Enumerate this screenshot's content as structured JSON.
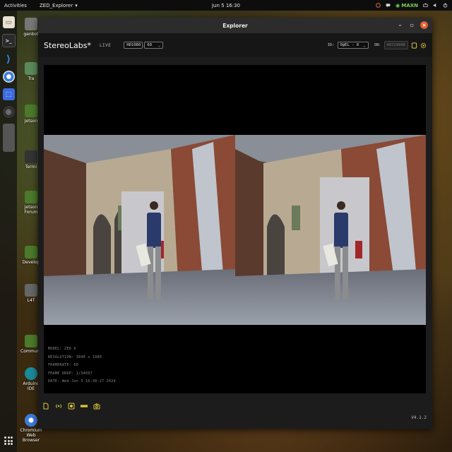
{
  "topbar": {
    "activities": "Activities",
    "app_name": "ZED_Explorer",
    "clock": "Jun 5  16:30",
    "power_mode": "MAXN"
  },
  "desktop": {
    "icons": [
      "genbot",
      "Tra",
      "Jetson",
      "Termi",
      "Jetson Forum",
      "Develop",
      "L4T",
      "Community",
      "Arduino IDE",
      "Chromium Web Browser"
    ]
  },
  "window": {
    "title": "Explorer"
  },
  "toolbar": {
    "brand": "StereoLabs*",
    "live": "LIVE",
    "resolution": "HD1080",
    "fps": "60",
    "id_label": "ID:",
    "id_value": "0@EL - 0",
    "sn_label": "SN:",
    "sn_value": "40729998"
  },
  "info": {
    "model": "MODEL: ZED X",
    "resolution": "RESOLUTION: 3840 x 1080",
    "framerate": "FRAMERATE: 60",
    "frame_drop": "FRAME DROP: 1/34697",
    "date": "DATE: Wed Jun 5 16:30:27 2024"
  },
  "bottom": {
    "version": "V4.1.2"
  },
  "colors": {
    "accent": "#d8c83a",
    "close": "#e05a2a",
    "maxn": "#7ad35a"
  }
}
